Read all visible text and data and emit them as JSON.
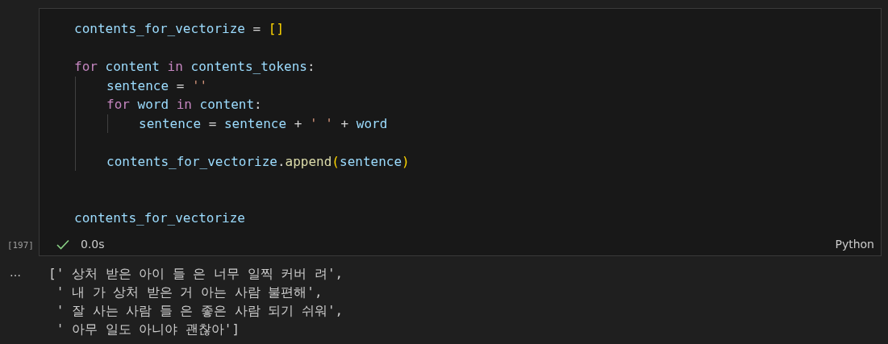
{
  "cell": {
    "execution_count": "[197]",
    "code": [
      {
        "kind": "code",
        "tokens": [
          {
            "text": "contents_for_vectorize",
            "kind": "var"
          },
          {
            "text": " = ",
            "kind": "op"
          },
          {
            "text": "[]",
            "kind": "bracket"
          }
        ]
      },
      {
        "kind": "blank"
      },
      {
        "kind": "code",
        "tokens": [
          {
            "text": "for",
            "kind": "kw"
          },
          {
            "text": " content ",
            "kind": "var"
          },
          {
            "text": "in",
            "kind": "kw"
          },
          {
            "text": " contents_tokens",
            "kind": "var"
          },
          {
            "text": ":",
            "kind": "op"
          }
        ],
        "body": [
          {
            "kind": "code",
            "tokens": [
              {
                "text": "sentence",
                "kind": "var"
              },
              {
                "text": " = ",
                "kind": "op"
              },
              {
                "text": "''",
                "kind": "str"
              }
            ]
          },
          {
            "kind": "code",
            "tokens": [
              {
                "text": "for",
                "kind": "kw"
              },
              {
                "text": " word ",
                "kind": "var"
              },
              {
                "text": "in",
                "kind": "kw"
              },
              {
                "text": " content",
                "kind": "var"
              },
              {
                "text": ":",
                "kind": "op"
              }
            ],
            "body": [
              {
                "kind": "code",
                "tokens": [
                  {
                    "text": "sentence",
                    "kind": "var"
                  },
                  {
                    "text": " = ",
                    "kind": "op"
                  },
                  {
                    "text": "sentence",
                    "kind": "var"
                  },
                  {
                    "text": " + ",
                    "kind": "op"
                  },
                  {
                    "text": "' '",
                    "kind": "str"
                  },
                  {
                    "text": " + ",
                    "kind": "op"
                  },
                  {
                    "text": "word",
                    "kind": "var"
                  }
                ]
              }
            ]
          },
          {
            "kind": "blank"
          },
          {
            "kind": "code",
            "tokens": [
              {
                "text": "contents_for_vectorize",
                "kind": "var"
              },
              {
                "text": ".",
                "kind": "op"
              },
              {
                "text": "append",
                "kind": "func"
              },
              {
                "text": "(",
                "kind": "bracket"
              },
              {
                "text": "sentence",
                "kind": "var"
              },
              {
                "text": ")",
                "kind": "bracket"
              }
            ]
          }
        ]
      },
      {
        "kind": "blank"
      },
      {
        "kind": "blank"
      },
      {
        "kind": "code",
        "tokens": [
          {
            "text": "contents_for_vectorize",
            "kind": "var"
          }
        ]
      }
    ],
    "status": {
      "succeeded": true,
      "duration": "0.0s",
      "language": "Python"
    }
  },
  "output": {
    "more": "…",
    "lines": [
      "[' 상처 받은 아이 들 은 너무 일찍 커버 려',",
      " ' 내 가 상처 받은 거 아는 사람 불편해',",
      " ' 잘 사는 사람 들 은 좋은 사람 되기 쉬워',",
      " ' 아무 일도 아니야 괜찮아']"
    ]
  }
}
